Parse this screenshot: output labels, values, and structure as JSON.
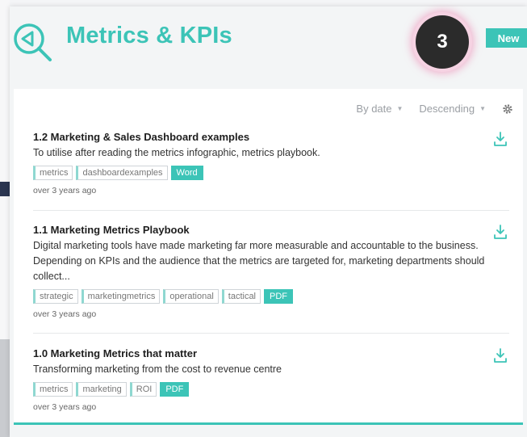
{
  "header": {
    "title": "Metrics & KPIs",
    "step_number": "3",
    "new_label": "New"
  },
  "toolbar": {
    "sort_by": "By date",
    "sort_order": "Descending"
  },
  "items": [
    {
      "title": "1.2 Marketing & Sales Dashboard examples",
      "description": "To utilise after reading the metrics infographic, metrics playbook.",
      "tags": [
        "metrics",
        "dashboardexamples"
      ],
      "file_type": "Word",
      "age": "over 3 years ago"
    },
    {
      "title": "1.1 Marketing Metrics Playbook",
      "description": "Digital marketing tools have made marketing far more measurable and accountable to the business. Depending on KPIs and the audience that the metrics are targeted for, marketing departments should collect...",
      "tags": [
        "strategic",
        "marketingmetrics",
        "operational",
        "tactical"
      ],
      "file_type": "PDF",
      "age": "over 3 years ago"
    },
    {
      "title": "1.0 Marketing Metrics that matter",
      "description": "Transforming marketing from the cost to revenue centre",
      "tags": [
        "metrics",
        "marketing",
        "ROI"
      ],
      "file_type": "PDF",
      "age": "over 3 years ago"
    }
  ],
  "colors": {
    "accent": "#3cc4b7",
    "badge": "#2b2b2b",
    "badge_glow": "#ec78aa"
  }
}
